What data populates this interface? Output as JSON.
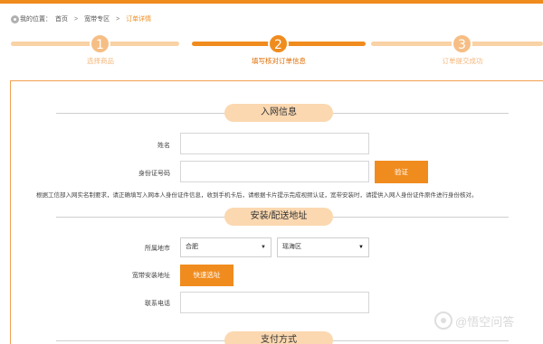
{
  "breadcrumb": {
    "prefix": "我的位置：",
    "items": [
      {
        "label": "首页"
      },
      {
        "label": "宽带专区"
      },
      {
        "label": "订单详情"
      }
    ],
    "separator": ">"
  },
  "steps": [
    {
      "number": "1",
      "label": "选择商品",
      "state": "done"
    },
    {
      "number": "2",
      "label": "填写核对订单信息",
      "state": "active"
    },
    {
      "number": "3",
      "label": "订单提交成功",
      "state": "pending"
    }
  ],
  "section_network": {
    "title": "入网信息",
    "name_label": "姓名",
    "name_value": "",
    "id_label": "身份证号码",
    "id_value": "",
    "verify_button": "验证",
    "notice": "根据工信部入网实名制要求，请正确填写入网本人身份证件信息，收到手机卡后，请根据卡片提示完成视频认证，宽带安装时，请提供入网人身份证件原件进行身份核对。"
  },
  "section_address": {
    "title": "安装/配送地址",
    "region_label": "所属地市",
    "city_value": "合肥",
    "district_value": "瑶海区",
    "install_label": "宽带安装地址",
    "install_button": "快速选址",
    "phone_label": "联系电话",
    "phone_value": ""
  },
  "section_payment": {
    "title": "支付方式"
  },
  "watermark": {
    "text": "@悟空问答"
  },
  "colors": {
    "accent": "#f08c1e",
    "accent_light": "#fbd8b0"
  }
}
